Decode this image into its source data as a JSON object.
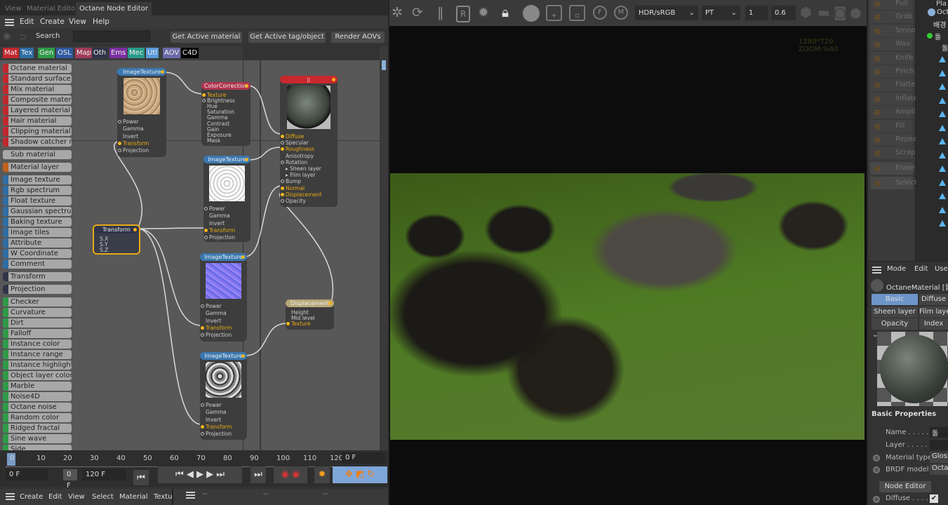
{
  "tabs": [
    "View",
    "Material Editor",
    "Octane Node Editor"
  ],
  "menu": [
    "Edit",
    "Create",
    "View",
    "Help"
  ],
  "search": {
    "label": "Search",
    "value": ""
  },
  "toolbar": {
    "get_material": "Get Active material",
    "get_tag": "Get Active tag/object",
    "render_aovs": "Render AOVs"
  },
  "categories": [
    {
      "label": "Mat",
      "color": "#c0282d"
    },
    {
      "label": "Tex",
      "color": "#2e6da4"
    },
    {
      "label": "Gen",
      "color": "#2f9a48"
    },
    {
      "label": "OSL",
      "color": "#2f5aa0"
    },
    {
      "label": "Map",
      "color": "#a03b5a"
    },
    {
      "label": "Oth",
      "color": "#2f3448"
    },
    {
      "label": "Ems",
      "color": "#7b2fa0"
    },
    {
      "label": "Mec",
      "color": "#2a9a8a"
    },
    {
      "label": "Utl",
      "color": "#5a9ad8"
    },
    {
      "label": "AOV",
      "color": "#6a6aa8"
    },
    {
      "label": "C4D",
      "color": "#000000"
    }
  ],
  "node_list": [
    {
      "label": "Octane material",
      "color": "#c0282d"
    },
    {
      "label": "Standard surface",
      "color": "#c0282d"
    },
    {
      "label": "Mix material",
      "color": "#c0282d"
    },
    {
      "label": "Composite materi",
      "color": "#c0282d"
    },
    {
      "label": "Layered material",
      "color": "#c0282d"
    },
    {
      "label": "Hair material",
      "color": "#c0282d"
    },
    {
      "label": "Clipping material",
      "color": "#c0282d"
    },
    {
      "label": "Shadow catcher m",
      "color": "#c0282d"
    },
    {
      "label": "Sub material",
      "color": ""
    },
    {
      "label": "Material layer",
      "color": "#c0601a"
    },
    {
      "label": "Image texture",
      "color": "#2e6da4"
    },
    {
      "label": "Rgb spectrum",
      "color": "#2e6da4"
    },
    {
      "label": "Float texture",
      "color": "#2e6da4"
    },
    {
      "label": "Gaussian spectrur",
      "color": "#2e6da4"
    },
    {
      "label": "Baking texture",
      "color": "#2e6da4"
    },
    {
      "label": "Image tiles",
      "color": "#2e6da4"
    },
    {
      "label": "Attribute",
      "color": "#2e6da4"
    },
    {
      "label": "W Coordinate",
      "color": "#2e6da4"
    },
    {
      "label": "Comment",
      "color": "#2e6da4"
    },
    {
      "label": "Transform",
      "color": "#2f3448"
    },
    {
      "label": "Projection",
      "color": "#2f3448"
    },
    {
      "label": "Checker",
      "color": "#2f9a48"
    },
    {
      "label": "Curvature",
      "color": "#2f9a48"
    },
    {
      "label": "Dirt",
      "color": "#2f9a48"
    },
    {
      "label": "Falloff",
      "color": "#2f9a48"
    },
    {
      "label": "Instance color",
      "color": "#2f9a48"
    },
    {
      "label": "Instance range",
      "color": "#2f9a48"
    },
    {
      "label": "Instance highlight",
      "color": "#2f9a48"
    },
    {
      "label": "Object layer color",
      "color": "#2f9a48"
    },
    {
      "label": "Marble",
      "color": "#2f9a48"
    },
    {
      "label": "Noise4D",
      "color": "#2f9a48"
    },
    {
      "label": "Octane noise",
      "color": "#2f9a48"
    },
    {
      "label": "Random color",
      "color": "#2f9a48"
    },
    {
      "label": "Ridged fractal",
      "color": "#2f9a48"
    },
    {
      "label": "Sine wave",
      "color": "#2f9a48"
    },
    {
      "label": "Side",
      "color": "#2f9a48"
    }
  ],
  "nodes": [
    {
      "id": "imagetexture-1",
      "title": "ImageTexture",
      "color": "#3b78b0",
      "thumb": "sand",
      "ports": [
        {
          "l": "Power"
        },
        {
          "l": "Gamma",
          "n": 1
        },
        {
          "l": "Invert",
          "n": 1
        },
        {
          "l": "Transform",
          "on": 1
        },
        {
          "l": "Projection"
        }
      ]
    },
    {
      "id": "colorcorrection",
      "title": "ColorCorrection",
      "color": "#b0344f",
      "ports": [
        {
          "l": "Texture",
          "on": 1
        },
        {
          "l": "Brightness"
        },
        {
          "l": "Hue",
          "n": 1
        },
        {
          "l": "Saturation",
          "n": 1
        },
        {
          "l": "Gamma",
          "n": 1
        },
        {
          "l": "Contrast",
          "n": 1
        },
        {
          "l": "Gain",
          "n": 1
        },
        {
          "l": "Exposure",
          "n": 1
        },
        {
          "l": "Mask",
          "n": 1
        }
      ]
    },
    {
      "id": "octane-material",
      "title": "▯",
      "color": "#c8282d",
      "thumb": "sphere",
      "ports": [
        {
          "l": "Diffuse",
          "on": 1
        },
        {
          "l": "Specular"
        },
        {
          "l": "Roughness",
          "on": 1
        },
        {
          "l": "Anisotropy",
          "n": 1
        },
        {
          "l": "Rotation"
        },
        {
          "l": "▸ Sheen layer",
          "n": 1
        },
        {
          "l": "▸ Film layer",
          "n": 1
        },
        {
          "l": "Bump"
        },
        {
          "l": "Normal",
          "on": 1
        },
        {
          "l": "Displacement",
          "on": 1
        },
        {
          "l": "Opacity"
        }
      ]
    },
    {
      "id": "imagetexture-2",
      "title": "ImageTexture",
      "color": "#3b78b0",
      "thumb": "white",
      "ports": [
        {
          "l": "Power"
        },
        {
          "l": "Gamma",
          "n": 1
        },
        {
          "l": "Invert",
          "n": 1
        },
        {
          "l": "Transform",
          "on": 1
        },
        {
          "l": "Projection"
        }
      ]
    },
    {
      "id": "transform",
      "title": "Transform",
      "color": "#2f3448",
      "ports": [
        {
          "l": "S.X",
          "n": 1
        },
        {
          "l": "S.Y",
          "n": 1
        },
        {
          "l": "S.Z",
          "n": 1
        }
      ]
    },
    {
      "id": "imagetexture-3",
      "title": "ImageTexture",
      "color": "#3b78b0",
      "thumb": "normal",
      "ports": [
        {
          "l": "Power"
        },
        {
          "l": "Gamma",
          "n": 1
        },
        {
          "l": "Invert",
          "n": 1
        },
        {
          "l": "Transform",
          "on": 1
        },
        {
          "l": "Projection"
        }
      ]
    },
    {
      "id": "displacement",
      "title": "Displacement",
      "color": "#b8a777",
      "ports": [
        {
          "l": "Height",
          "n": 1
        },
        {
          "l": "Mid level",
          "n": 1
        },
        {
          "l": "Texture",
          "on": 1
        }
      ]
    },
    {
      "id": "imagetexture-4",
      "title": "ImageTexture",
      "color": "#3b78b0",
      "thumb": "gray",
      "ports": [
        {
          "l": "Power"
        },
        {
          "l": "Gamma",
          "n": 1
        },
        {
          "l": "Invert",
          "n": 1
        },
        {
          "l": "Transform",
          "on": 1
        },
        {
          "l": "Projection"
        }
      ]
    }
  ],
  "timeline": {
    "ticks": [
      "0",
      "10",
      "20",
      "30",
      "40",
      "50",
      "60",
      "70",
      "80",
      "90",
      "100",
      "110",
      "120"
    ],
    "current": "0 F",
    "start": "0 F",
    "offset": "0 F",
    "end": "120 F"
  },
  "bottom_menu": [
    "Create",
    "Edit",
    "View",
    "Select",
    "Material",
    "Textu"
  ],
  "bottom_right": [
    "--",
    "--",
    "--"
  ],
  "viewport": {
    "color_space": "HDR/sRGB",
    "kernel": "PT",
    "value1": "1",
    "value2": "0.6",
    "info": "1280*720 ZOOM:%60"
  },
  "sculpt_tools": [
    "Pull",
    "Grab",
    "Smooth",
    "Wax",
    "Knife",
    "Pinch",
    "Flatten",
    "Inflate",
    "Amplify",
    "Fill",
    "Repeat",
    "Scrape",
    "Erase",
    "Select"
  ],
  "tree": [
    "Pla",
    "Oct",
    "배경",
    "돌",
    "돌"
  ],
  "attributes": {
    "menu": [
      "Mode",
      "Edit",
      "User"
    ],
    "object": "OctaneMaterial [돌]",
    "tabs": [
      "Basic",
      "Diffuse",
      "Sheen layer",
      "Film layer",
      "Opacity",
      "Index"
    ],
    "section": "Basic Properties",
    "name_label": "Name . . . . .",
    "name_value": "돌",
    "layer_label": "Layer . . . . .",
    "material_type_label": "Material type",
    "material_type": "Glossy",
    "brdf_label": "BRDF model",
    "brdf": "Octane",
    "node_editor": "Node Editor",
    "diffuse_label": "Diffuse . . . .",
    "diffuse_checked": true
  }
}
